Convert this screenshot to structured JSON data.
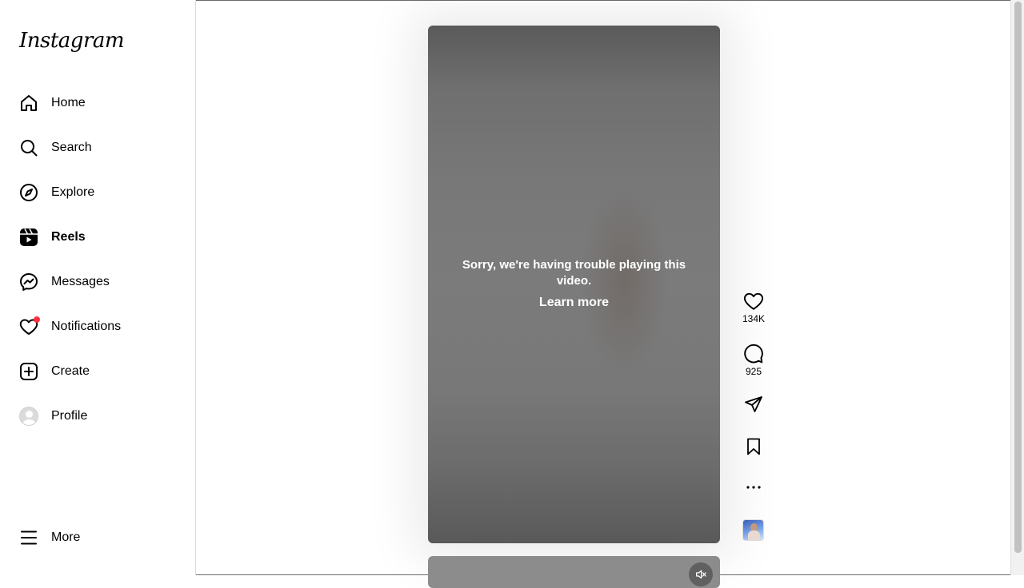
{
  "app": {
    "logo": "Instagram"
  },
  "sidebar": {
    "items": [
      {
        "label": "Home",
        "icon": "home-icon"
      },
      {
        "label": "Search",
        "icon": "search-icon"
      },
      {
        "label": "Explore",
        "icon": "compass-icon"
      },
      {
        "label": "Reels",
        "icon": "reels-icon",
        "active": true
      },
      {
        "label": "Messages",
        "icon": "messenger-icon"
      },
      {
        "label": "Notifications",
        "icon": "heart-icon",
        "badge": "red-dot"
      },
      {
        "label": "Create",
        "icon": "plus-square-icon"
      },
      {
        "label": "Profile",
        "icon": "avatar"
      }
    ],
    "more_label": "More"
  },
  "reel": {
    "error_message": "Sorry, we're having trouble playing this video.",
    "learn_more": "Learn more",
    "likes": "134K",
    "comments": "925"
  },
  "colors": {
    "notification_dot": "#ff3040",
    "video_overlay": "#787878"
  }
}
